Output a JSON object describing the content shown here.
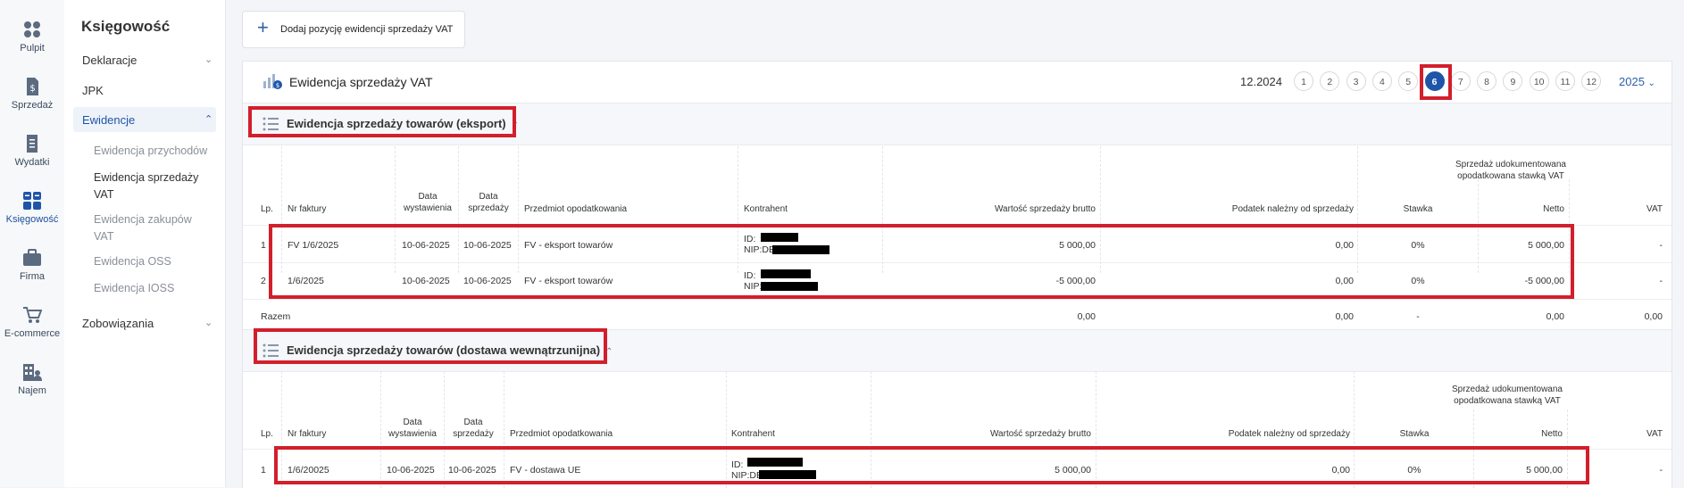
{
  "rail": {
    "items": [
      {
        "label": "Pulpit",
        "icon": "dashboard-icon"
      },
      {
        "label": "Sprzedaż",
        "icon": "sales-doc-icon"
      },
      {
        "label": "Wydatki",
        "icon": "expenses-doc-icon"
      },
      {
        "label": "Księgowość",
        "icon": "grid-icon"
      },
      {
        "label": "Firma",
        "icon": "briefcase-icon"
      },
      {
        "label": "E-commerce",
        "icon": "cart-icon"
      },
      {
        "label": "Najem",
        "icon": "building-icon"
      }
    ]
  },
  "sidebar": {
    "title": "Księgowość",
    "deklaracje": "Deklaracje",
    "jpk": "JPK",
    "ewidencje": "Ewidencje",
    "sub": [
      "Ewidencja przychodów",
      "Ewidencja sprzedaży VAT",
      "Ewidencja zakupów VAT",
      "Ewidencja OSS",
      "Ewidencja IOSS"
    ],
    "zobowiazania": "Zobowiązania"
  },
  "toolbar": {
    "add_label": "Dodaj pozycję ewidencji sprzedaży VAT"
  },
  "panel": {
    "title": "Ewidencja sprzedaży VAT",
    "period": "12.2024",
    "months": [
      "1",
      "2",
      "3",
      "4",
      "5",
      "6",
      "7",
      "8",
      "9",
      "10",
      "11",
      "12"
    ],
    "active_month": "6",
    "year": "2025"
  },
  "headers": {
    "lp": "Lp.",
    "nr": "Nr faktury",
    "data_wyst_1": "Data",
    "data_wyst_2": "wystawienia",
    "data_sprz_1": "Data",
    "data_sprz_2": "sprzedaży",
    "przedmiot": "Przedmiot opodatkowania",
    "kontrahent": "Kontrahent",
    "brutto": "Wartość sprzedaży brutto",
    "podatek": "Podatek należny od sprzedaży",
    "group_1": "Sprzedaż udokumentowana",
    "group_2": "opodatkowana stawką VAT",
    "stawka": "Stawka",
    "netto": "Netto",
    "vat": "VAT"
  },
  "section1": {
    "title": "Ewidencja sprzedaży towarów (eksport)",
    "rows": [
      {
        "lp": "1",
        "nr": "FV 1/6/2025",
        "wyst": "10-06-2025",
        "sprz": "10-06-2025",
        "przedmiot": "FV - eksport towarów",
        "id": "ID:",
        "nip": "NIP:DE",
        "brutto": "5 000,00",
        "podatek": "0,00",
        "stawka": "0%",
        "netto": "5 000,00",
        "vat": "-"
      },
      {
        "lp": "2",
        "nr": "1/6/2025",
        "wyst": "10-06-2025",
        "sprz": "10-06-2025",
        "przedmiot": "FV - eksport towarów",
        "id": "ID:",
        "nip": "NIP:DE",
        "brutto": "-5 000,00",
        "podatek": "0,00",
        "stawka": "0%",
        "netto": "-5 000,00",
        "vat": "-"
      }
    ],
    "total": {
      "label": "Razem",
      "brutto": "0,00",
      "podatek": "0,00",
      "stawka": "-",
      "netto": "0,00",
      "vat": "0,00"
    }
  },
  "section2": {
    "title": "Ewidencja sprzedaży towarów (dostawa wewnątrzunijna)",
    "rows": [
      {
        "lp": "1",
        "nr": "1/6/20025",
        "wyst": "10-06-2025",
        "sprz": "10-06-2025",
        "przedmiot": "FV - dostawa UE",
        "id": "ID:",
        "nip": "NIP:DE",
        "brutto": "5 000,00",
        "podatek": "0,00",
        "stawka": "0%",
        "netto": "5 000,00",
        "vat": "-"
      }
    ]
  },
  "colors": {
    "accent": "#1f55a9",
    "highlight": "#d21f2b"
  }
}
